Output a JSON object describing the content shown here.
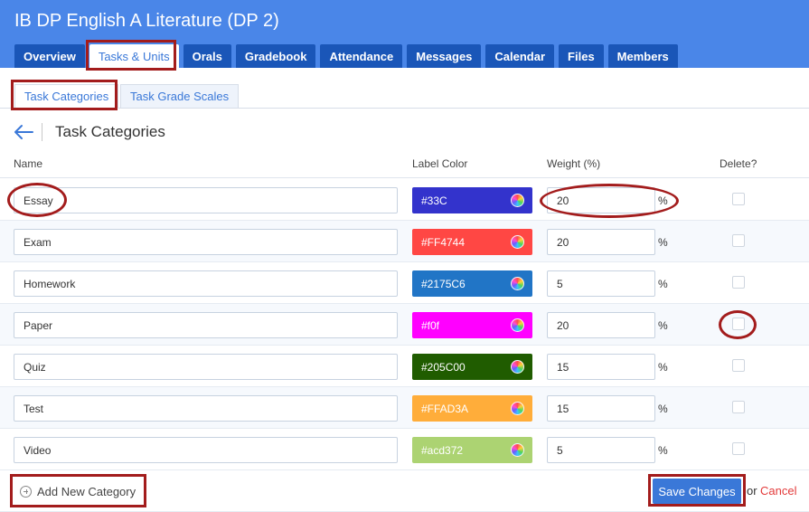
{
  "header": {
    "title": "IB DP English A Literature (DP 2)",
    "tabs": [
      "Overview",
      "Tasks & Units",
      "Orals",
      "Gradebook",
      "Attendance",
      "Messages",
      "Calendar",
      "Files",
      "Members"
    ],
    "active_tab": "Tasks & Units"
  },
  "subtabs": {
    "items": [
      "Task Categories",
      "Task Grade Scales"
    ],
    "active": "Task Categories"
  },
  "page": {
    "back_icon": "arrow-left-icon",
    "title": "Task Categories"
  },
  "table": {
    "columns": {
      "name": "Name",
      "label_color": "Label Color",
      "weight": "Weight (%)",
      "delete": "Delete?"
    },
    "percent_sign": "%",
    "rows": [
      {
        "name": "Essay",
        "color_label": "#33C",
        "color": "#3333cc",
        "weight": "20",
        "delete": false
      },
      {
        "name": "Exam",
        "color_label": "#FF4744",
        "color": "#ff4744",
        "weight": "20",
        "delete": false
      },
      {
        "name": "Homework",
        "color_label": "#2175C6",
        "color": "#2175c6",
        "weight": "5",
        "delete": false
      },
      {
        "name": "Paper",
        "color_label": "#f0f",
        "color": "#ff00ff",
        "weight": "20",
        "delete": false
      },
      {
        "name": "Quiz",
        "color_label": "#205C00",
        "color": "#205c00",
        "weight": "15",
        "delete": false
      },
      {
        "name": "Test",
        "color_label": "#FFAD3A",
        "color": "#ffad3a",
        "weight": "15",
        "delete": false
      },
      {
        "name": "Video",
        "color_label": "#acd372",
        "color": "#acd372",
        "weight": "5",
        "delete": false
      }
    ]
  },
  "footer": {
    "add_label": "Add New Category",
    "save_label": "Save Changes",
    "or_text": "or",
    "cancel_label": "Cancel"
  },
  "colors": {
    "header_bg": "#4a86e8",
    "tab_bg": "#1a56b8",
    "accent": "#3a78d8",
    "highlight": "#a31c1c",
    "cancel": "#e33b3b"
  }
}
